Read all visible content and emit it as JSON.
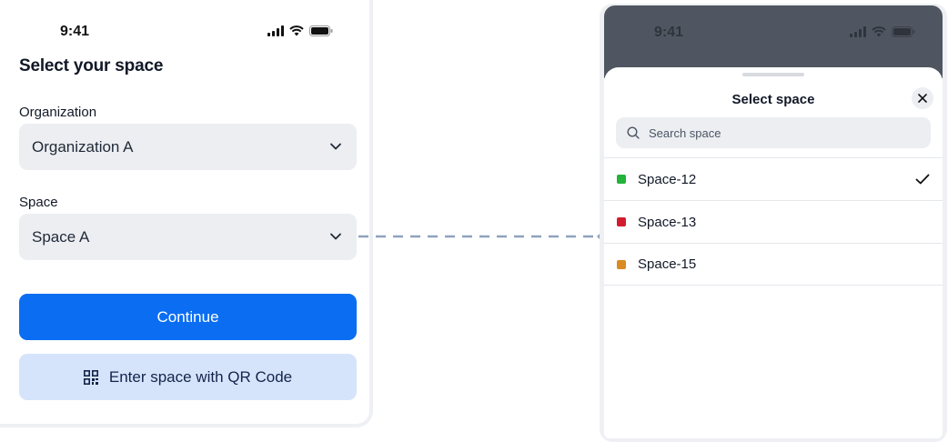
{
  "left": {
    "status_time": "9:41",
    "title": "Select your space",
    "organization": {
      "label": "Organization",
      "value": "Organization A"
    },
    "space": {
      "label": "Space",
      "value": "Space A"
    },
    "continue_label": "Continue",
    "qr_label": "Enter space with QR Code"
  },
  "right": {
    "status_time": "9:41",
    "sheet_title": "Select space",
    "search_placeholder": "Search space",
    "items": [
      {
        "label": "Space-12",
        "color": "#22b33a",
        "selected": true
      },
      {
        "label": "Space-13",
        "color": "#d21c2e",
        "selected": false
      },
      {
        "label": "Space-15",
        "color": "#d98b22",
        "selected": false
      }
    ]
  },
  "colors": {
    "primary": "#0b6ef2",
    "secondary_bg": "#d6e4fb",
    "connector": "#8fa1bd"
  }
}
